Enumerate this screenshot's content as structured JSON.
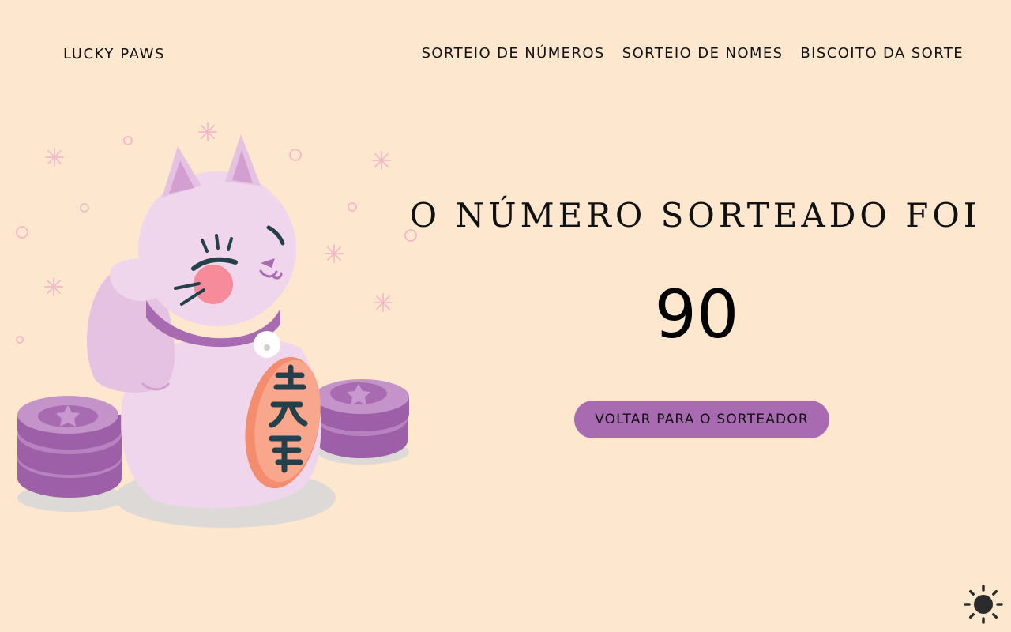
{
  "header": {
    "brand": "LUCKY PAWS",
    "nav": [
      {
        "label": "SORTEIO DE NÚMEROS"
      },
      {
        "label": "SORTEIO DE NOMES"
      },
      {
        "label": "BISCOITO DA SORTE"
      }
    ]
  },
  "main": {
    "title": "O NÚMERO SORTEADO FOI",
    "number": "90",
    "back_button": "VOLTAR PARA O SORTEADOR"
  },
  "illustration": {
    "name": "maneki-neko-cat-illustration",
    "coin_charm_text": "千万両"
  },
  "theme_toggle": {
    "icon": "sun-icon"
  },
  "colors": {
    "background": "#fde7cf",
    "accent": "#a86bb1",
    "text": "#111111"
  }
}
